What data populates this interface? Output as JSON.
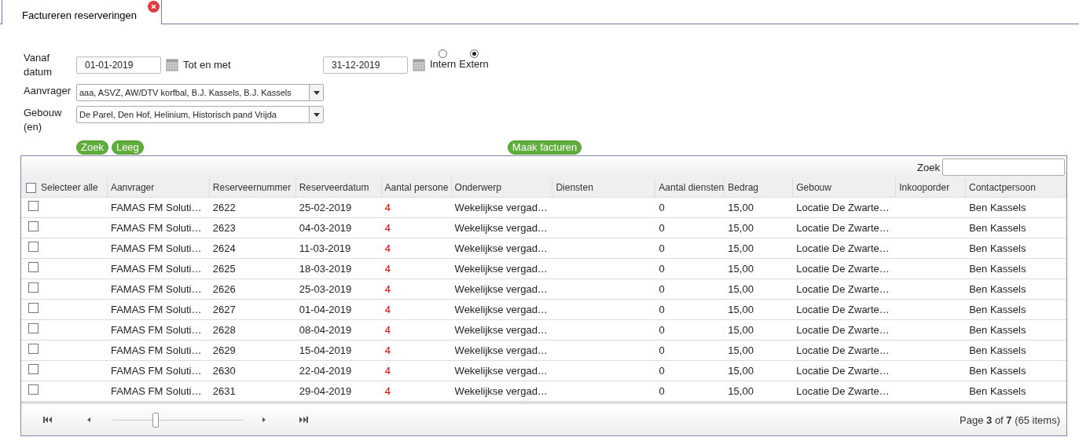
{
  "tab": {
    "label": "Factureren reserveringen",
    "selected": true
  },
  "filter": {
    "from_label": "Vanaf datum",
    "from_value": "01-01-2019",
    "to_label": "Tot en met",
    "to_value": "31-12-2019",
    "radios": [
      {
        "label": "Intern",
        "selected": false
      },
      {
        "label": "Extern",
        "selected": true
      }
    ],
    "applicant_label": "Aanvrager",
    "applicant_value": "aaa, ASVZ, AW/DTV korfbal, B.J. Kassels, B.J. Kassels",
    "building_label": "Gebouw (en)",
    "building_value": "De Parel, Den Hof, Helinium, Historisch pand Vrijda",
    "buttons": [
      "Zoek",
      "Leeg"
    ],
    "invoice_button": "Maak facturen"
  },
  "table": {
    "search_label": "Zoek",
    "select_all": {
      "label": "Selecteer alle",
      "checked": false
    },
    "columns": [
      "Aanvrager",
      "Reserveernummer",
      "Reserveerdatum",
      "Aantal persone",
      "Onderwerp",
      "Diensten",
      "Aantal diensten",
      "Bedrag",
      "Gebouw",
      "Inkooporder",
      "Contactpersoon"
    ],
    "rows": [
      {
        "checked": false,
        "cells": [
          "FAMAS FM Soluti…",
          "2622",
          "25-02-2019",
          "4",
          "Wekelijkse vergad…",
          "",
          "0",
          "15,00",
          "Locatie De Zwarte…",
          "",
          "Ben Kassels"
        ]
      },
      {
        "checked": false,
        "cells": [
          "FAMAS FM Soluti…",
          "2623",
          "04-03-2019",
          "4",
          "Wekelijkse vergad…",
          "",
          "0",
          "15,00",
          "Locatie De Zwarte…",
          "",
          "Ben Kassels"
        ]
      },
      {
        "checked": false,
        "cells": [
          "FAMAS FM Soluti…",
          "2624",
          "11-03-2019",
          "4",
          "Wekelijkse vergad…",
          "",
          "0",
          "15,00",
          "Locatie De Zwarte…",
          "",
          "Ben Kassels"
        ]
      },
      {
        "checked": false,
        "cells": [
          "FAMAS FM Soluti…",
          "2625",
          "18-03-2019",
          "4",
          "Wekelijkse vergad…",
          "",
          "0",
          "15,00",
          "Locatie De Zwarte…",
          "",
          "Ben Kassels"
        ]
      },
      {
        "checked": false,
        "cells": [
          "FAMAS FM Soluti…",
          "2626",
          "25-03-2019",
          "4",
          "Wekelijkse vergad…",
          "",
          "0",
          "15,00",
          "Locatie De Zwarte…",
          "",
          "Ben Kassels"
        ]
      },
      {
        "checked": false,
        "cells": [
          "FAMAS FM Soluti…",
          "2627",
          "01-04-2019",
          "4",
          "Wekelijkse vergad…",
          "",
          "0",
          "15,00",
          "Locatie De Zwarte…",
          "",
          "Ben Kassels"
        ]
      },
      {
        "checked": false,
        "cells": [
          "FAMAS FM Soluti…",
          "2628",
          "08-04-2019",
          "4",
          "Wekelijkse vergad…",
          "",
          "0",
          "15,00",
          "Locatie De Zwarte…",
          "",
          "Ben Kassels"
        ]
      },
      {
        "checked": false,
        "cells": [
          "FAMAS FM Soluti…",
          "2629",
          "15-04-2019",
          "4",
          "Wekelijkse vergad…",
          "",
          "0",
          "15,00",
          "Locatie De Zwarte…",
          "",
          "Ben Kassels"
        ]
      },
      {
        "checked": false,
        "cells": [
          "FAMAS FM Soluti…",
          "2630",
          "22-04-2019",
          "4",
          "Wekelijkse vergad…",
          "",
          "0",
          "15,00",
          "Locatie De Zwarte…",
          "",
          "Ben Kassels"
        ]
      },
      {
        "checked": false,
        "cells": [
          "FAMAS FM Soluti…",
          "2631",
          "29-04-2019",
          "4",
          "Wekelijkse vergad…",
          "",
          "0",
          "15,00",
          "Locatie De Zwarte…",
          "",
          "Ben Kassels"
        ]
      }
    ]
  },
  "pager": {
    "level": 0.33,
    "info": "Page **3** of **7** (65 items)"
  }
}
